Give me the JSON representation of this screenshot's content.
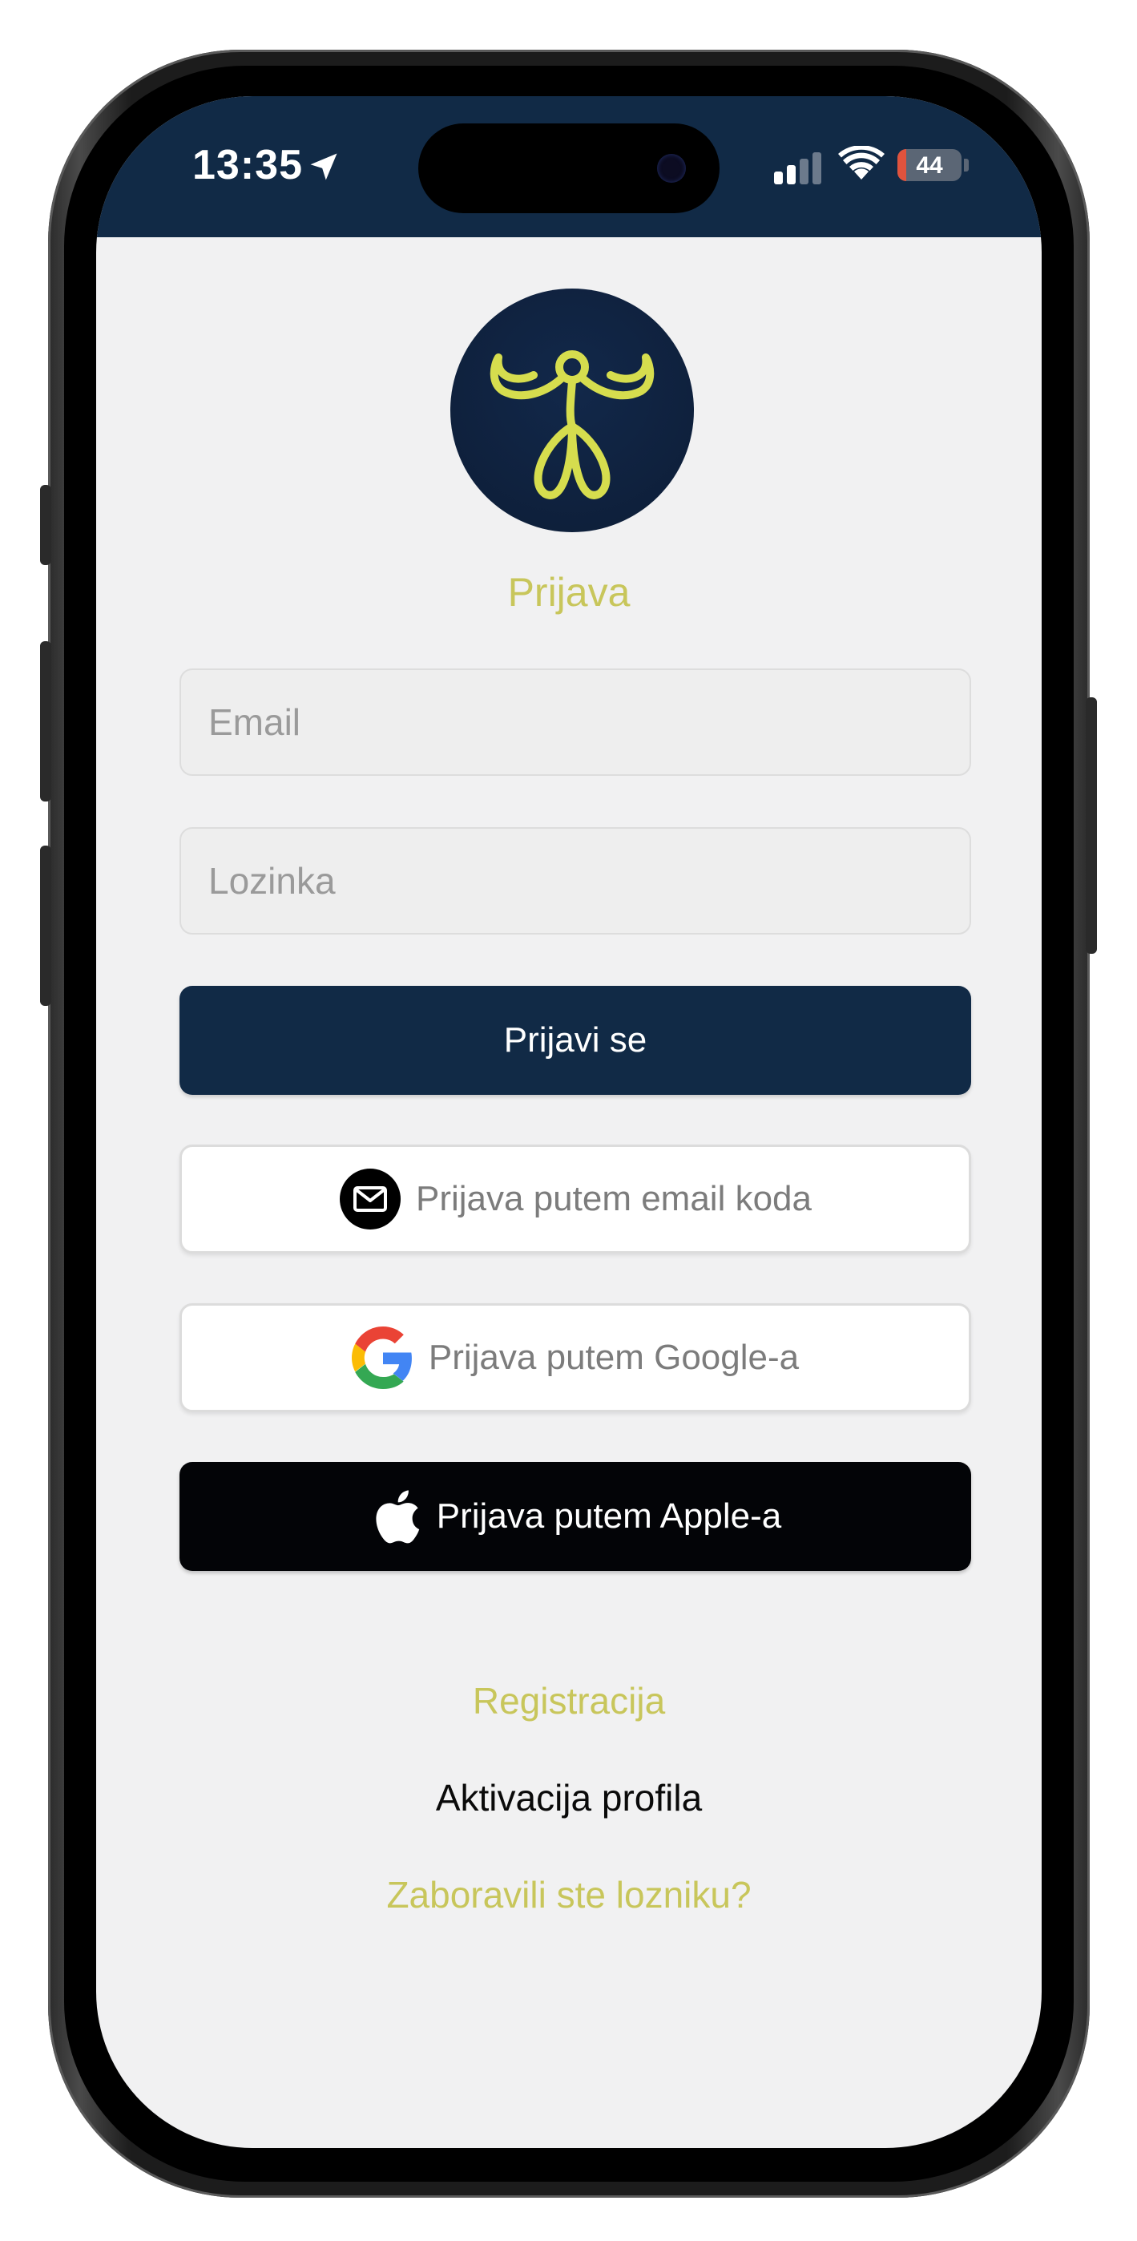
{
  "status_bar": {
    "time": "13:35",
    "battery": {
      "level_label": "44",
      "level_percent": 44,
      "charging": true,
      "low_color": "#e0533d"
    },
    "icons": [
      "location-arrow-icon",
      "cellular-signal-icon",
      "wifi-icon",
      "battery-charging-icon"
    ]
  },
  "colors": {
    "brand_navy": "#112a46",
    "accent_lime": "#c8c65b",
    "background": "#f1f1f2",
    "apple_button": "#030407"
  },
  "login": {
    "title": "Prijava",
    "email_placeholder": "Email",
    "password_placeholder": "Lozinka",
    "submit_label": "Prijavi se",
    "email_code_label": "Prijava putem email koda",
    "google_label": "Prijava putem Google-a",
    "apple_label": "Prijava putem Apple-a"
  },
  "links": {
    "register": "Registracija",
    "activate": "Aktivacija profila",
    "forgot_password": "Zaboravili ste lozniku?"
  }
}
